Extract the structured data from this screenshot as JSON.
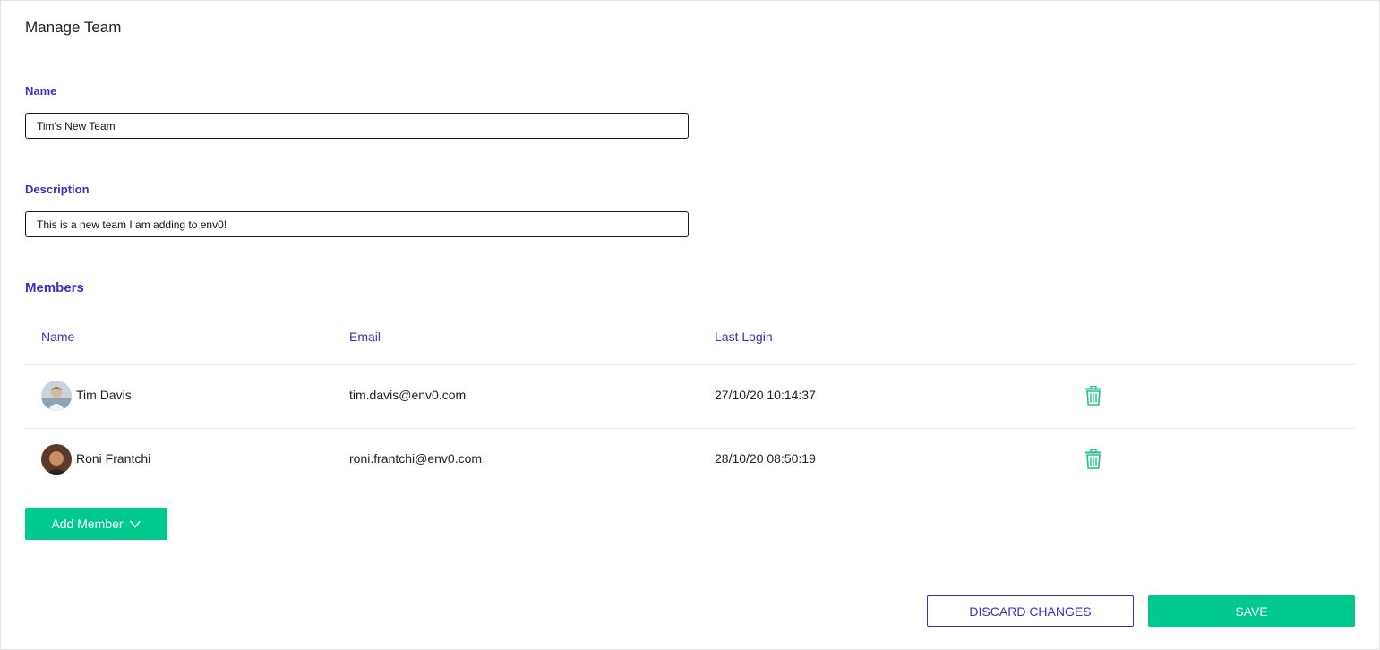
{
  "page": {
    "title": "Manage Team"
  },
  "form": {
    "name_label": "Name",
    "name_value": "Tim's New Team",
    "description_label": "Description",
    "description_value": "This is a new team I am adding to env0!"
  },
  "members": {
    "section_title": "Members",
    "columns": [
      "Name",
      "Email",
      "Last Login"
    ],
    "rows": [
      {
        "name": "Tim Davis",
        "email": "tim.davis@env0.com",
        "last_login": "27/10/20 10:14:37",
        "avatar": "user-avatar",
        "action_icon": "trash-icon"
      },
      {
        "name": "Roni Frantchi",
        "email": "roni.frantchi@env0.com",
        "last_login": "28/10/20 08:50:19",
        "avatar": "user-avatar",
        "action_icon": "trash-icon"
      }
    ],
    "add_button_label": "Add Member",
    "add_button_icon": "chevron-down-icon"
  },
  "footer": {
    "discard_label": "DISCARD CHANGES",
    "save_label": "SAVE"
  },
  "colors": {
    "accent": "#3a2fc4",
    "primary": "#00c98d",
    "trash": "#1fbf8f"
  }
}
